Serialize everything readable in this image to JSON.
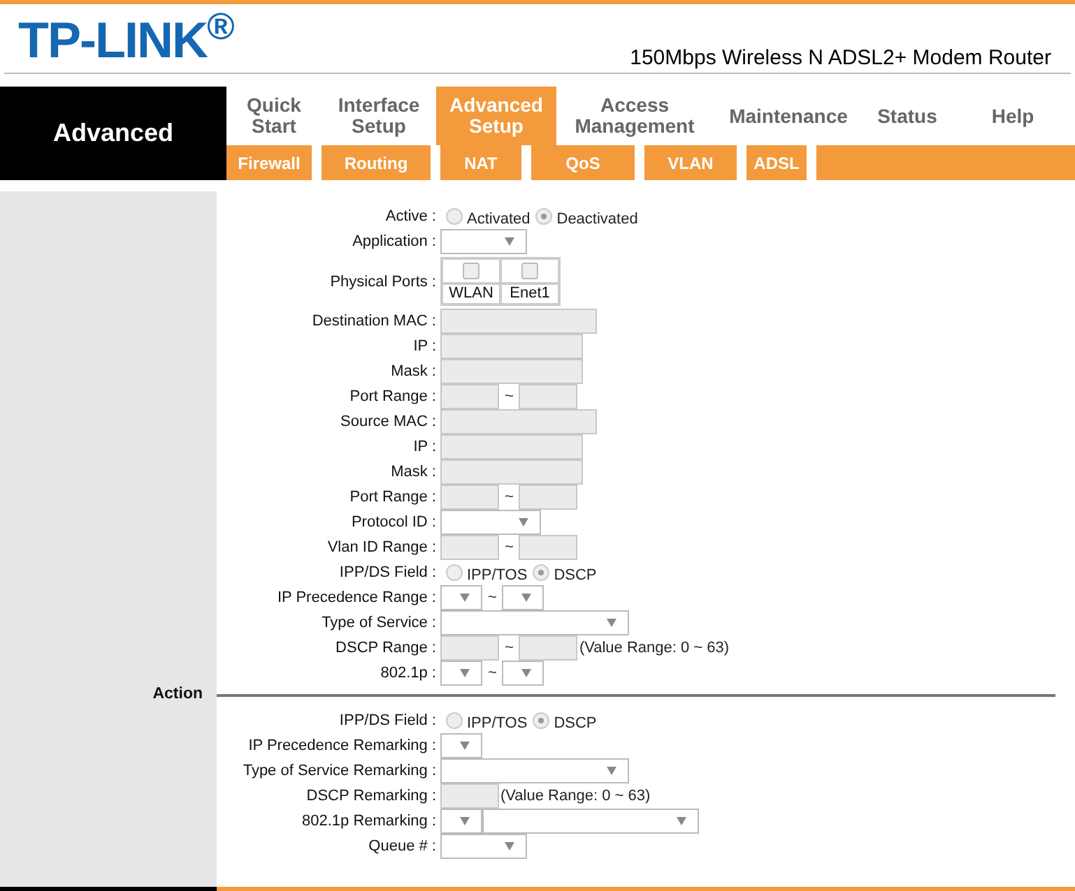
{
  "header": {
    "logo": "TP-LINK$^{®}$",
    "product": "150Mbps Wireless N ADSL2+ Modem Router"
  },
  "nav": {
    "section": "Advanced",
    "tabs": [
      {
        "label": "Quick Start",
        "selected": false
      },
      {
        "label": "Interface Setup",
        "selected": false
      },
      {
        "label": "Advanced Setup",
        "selected": true
      },
      {
        "label": "Access Management",
        "selected": false
      },
      {
        "label": "Maintenance",
        "selected": false
      },
      {
        "label": "Status",
        "selected": false
      },
      {
        "label": "Help",
        "selected": false
      }
    ],
    "subtabs": [
      {
        "label": "Firewall"
      },
      {
        "label": "Routing"
      },
      {
        "label": "NAT"
      },
      {
        "label": "QoS"
      },
      {
        "label": "VLAN"
      },
      {
        "label": "ADSL"
      }
    ]
  },
  "rule_fields": [
    {
      "label": "Active :",
      "kind": "radio",
      "options": [
        {
          "label": "Activated",
          "selected": false
        },
        {
          "label": "Deactivated",
          "selected": true
        }
      ]
    },
    {
      "label": "Application :",
      "kind": "select"
    },
    {
      "label": "Physical Ports :",
      "kind": "ports",
      "ports": [
        {
          "label": "WLAN",
          "checked": false
        },
        {
          "label": "Enet1",
          "checked": false
        }
      ]
    },
    {
      "label": "Destination MAC :",
      "kind": "wide_input"
    },
    {
      "label": "IP :",
      "kind": "input"
    },
    {
      "label": "Mask :",
      "kind": "input"
    },
    {
      "label": "Port Range :",
      "kind": "range",
      "separator": "~"
    },
    {
      "label": "Source MAC :",
      "kind": "wide_input"
    },
    {
      "label": "IP :",
      "kind": "input"
    },
    {
      "label": "Mask :",
      "kind": "input"
    },
    {
      "label": "Port Range :",
      "kind": "range",
      "separator": "~"
    },
    {
      "label": "Protocol ID :",
      "kind": "wide_select"
    },
    {
      "label": "Vlan ID Range :",
      "kind": "range",
      "separator": "~"
    },
    {
      "label": "IPP/DS Field :",
      "kind": "radio",
      "options": [
        {
          "label": "IPP/TOS",
          "selected": false
        },
        {
          "label": "DSCP",
          "selected": true
        }
      ]
    },
    {
      "label": "IP Precedence Range :",
      "kind": "select_range",
      "separator": "~"
    },
    {
      "label": "Type of Service :",
      "kind": "long_select"
    },
    {
      "label": "DSCP Range :",
      "kind": "range",
      "separator": "~",
      "note": "(Value Range: 0 ~ 63)"
    },
    {
      "label": "802.1p :",
      "kind": "select_range",
      "separator": "~"
    }
  ],
  "action": {
    "label": "Action",
    "fields": [
      {
        "label": "IPP/DS Field :",
        "kind": "radio",
        "options": [
          {
            "label": "IPP/TOS",
            "selected": false
          },
          {
            "label": "DSCP",
            "selected": true
          }
        ]
      },
      {
        "label": "IP Precedence Remarking :",
        "kind": "short_select"
      },
      {
        "label": "Type of Service Remarking :",
        "kind": "long_select"
      },
      {
        "label": "DSCP Remarking :",
        "kind": "short_input",
        "note": "(Value Range: 0 ~ 63)"
      },
      {
        "label": "802.1p Remarking :",
        "kind": "select_pair"
      },
      {
        "label": "Queue # :",
        "kind": "select"
      }
    ]
  }
}
